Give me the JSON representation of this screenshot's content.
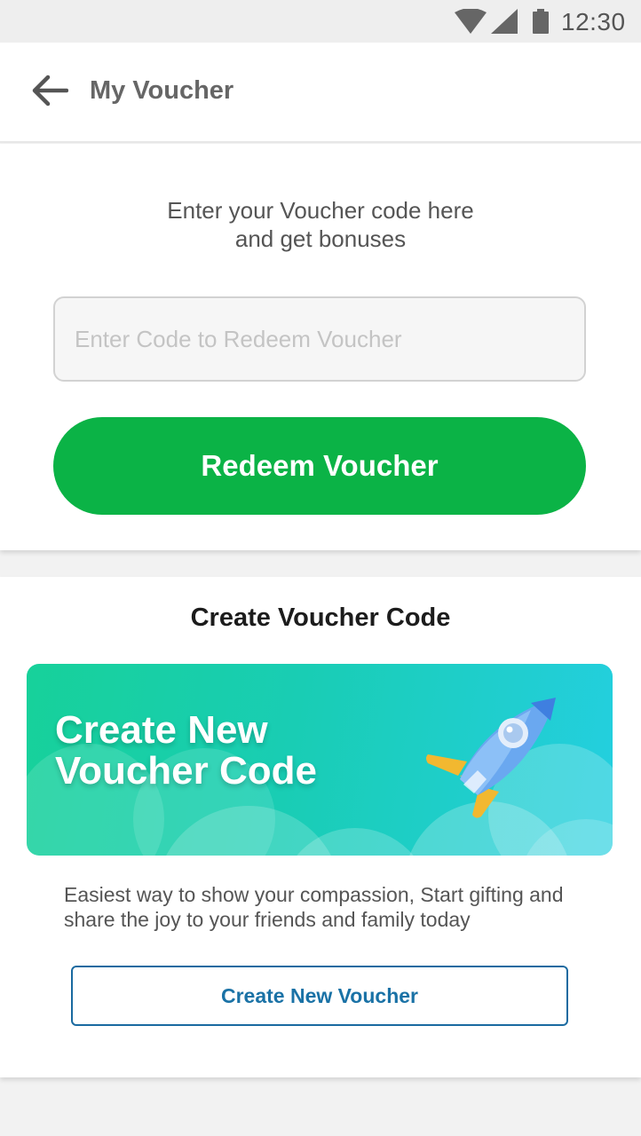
{
  "status_bar": {
    "time": "12:30",
    "icons": [
      "wifi-icon",
      "cell-signal-icon",
      "battery-icon"
    ]
  },
  "app_bar": {
    "back_icon": "arrow-left-icon",
    "title": "My Voucher"
  },
  "redeem": {
    "intro_line1": "Enter your Voucher code here",
    "intro_line2": "and get bonuses",
    "input_value": "",
    "input_placeholder": "Enter Code to Redeem Voucher",
    "button_label": "Redeem Voucher",
    "button_color": "#0bb346"
  },
  "create": {
    "section_title": "Create Voucher Code",
    "banner_line1": "Create New",
    "banner_line2": "Voucher Code",
    "banner_icon": "rocket-icon",
    "description": "Easiest way to show your compassion, Start gifting and share the joy to your friends and family today",
    "button_label": "Create New Voucher",
    "button_color": "#1a72a6"
  }
}
